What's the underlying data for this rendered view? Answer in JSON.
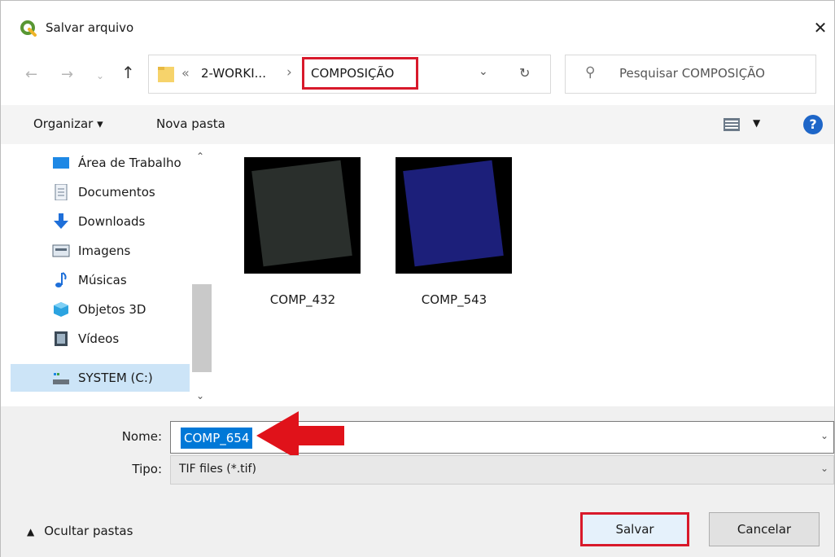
{
  "window": {
    "title": "Salvar arquivo"
  },
  "address": {
    "breadcrumb_sep": "«",
    "parent": "2-WORKI...",
    "separator": "›",
    "current": "COMPOSIÇÃO"
  },
  "search": {
    "placeholder": "Pesquisar COMPOSIÇÃO"
  },
  "toolbar": {
    "organize": "Organizar ▾",
    "new_folder": "Nova pasta"
  },
  "sidebar": {
    "items": [
      {
        "label": "Área de Trabalho",
        "icon": "desktop-icon"
      },
      {
        "label": "Documentos",
        "icon": "documents-icon"
      },
      {
        "label": "Downloads",
        "icon": "downloads-icon"
      },
      {
        "label": "Imagens",
        "icon": "pictures-icon"
      },
      {
        "label": "Músicas",
        "icon": "music-icon"
      },
      {
        "label": "Objetos 3D",
        "icon": "objects3d-icon"
      },
      {
        "label": "Vídeos",
        "icon": "videos-icon"
      },
      {
        "label": "SYSTEM (C:)",
        "icon": "drive-icon"
      }
    ]
  },
  "files": [
    {
      "name": "COMP_432",
      "tint": "#2a2f2c"
    },
    {
      "name": "COMP_543",
      "tint": "#1c1f7a"
    }
  ],
  "form": {
    "name_label": "Nome:",
    "name_value": "COMP_654",
    "type_label": "Tipo:",
    "type_value": "TIF files (*.tif)"
  },
  "footer": {
    "hide_folders": "Ocultar pastas",
    "save": "Salvar",
    "cancel": "Cancelar"
  },
  "colors": {
    "highlight_red": "#d8192b",
    "selection_blue": "#0078d7",
    "qgis_green": "#589632"
  }
}
